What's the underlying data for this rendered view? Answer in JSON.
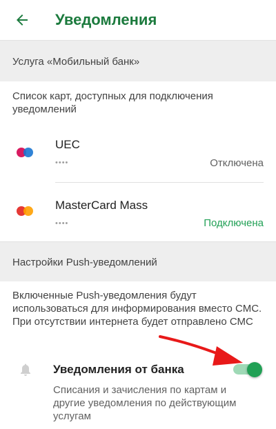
{
  "header": {
    "title": "Уведомления",
    "back_icon": "arrow-left-icon"
  },
  "sections": {
    "mobile_bank": "Услуга «Мобильный банк»",
    "push_settings": "Настройки Push-уведомлений"
  },
  "cards_description": "Список карт, доступных для подключения уведомлений",
  "cards": [
    {
      "name": "UEC",
      "mask": "••••",
      "status": "Отключена",
      "status_color": "#616161",
      "logo_colors": [
        "#d81b60",
        "#1976d2"
      ]
    },
    {
      "name": "MasterCard Mass",
      "mask": "••••",
      "status": "Подключена",
      "status_color": "#21a055",
      "logo_colors": [
        "#e53935",
        "#ffa000"
      ]
    }
  ],
  "push_description": "Включенные Push-уведомления будут использоваться для информирования вместо СМС. При отсутствии интернета будет отправлено СМС",
  "bank_notifications": {
    "title": "Уведомления от банка",
    "subtitle": "Списания и зачисления по картам и другие уведомления по действующим услугам",
    "enabled": true,
    "icon": "bell-icon"
  },
  "colors": {
    "brand": "#1b7a3d",
    "accent": "#21a055",
    "annotation_arrow": "#e81919"
  }
}
